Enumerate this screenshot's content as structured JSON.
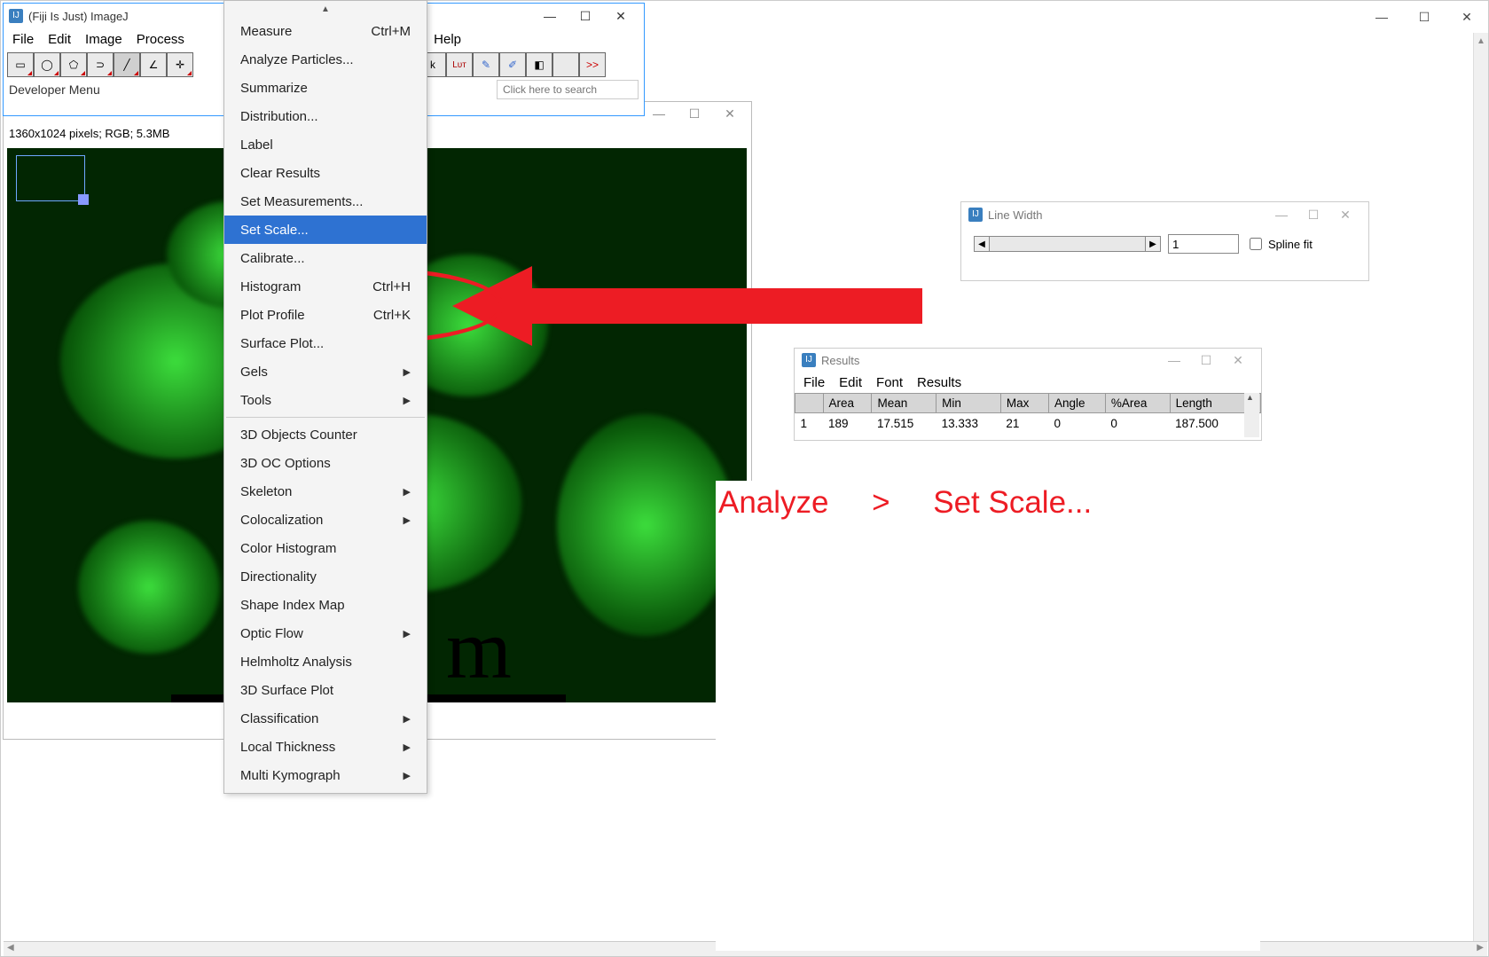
{
  "outer": {
    "minimize": "—",
    "maximize": "☐",
    "close": "✕"
  },
  "ij": {
    "icon_text": "IJ",
    "title": "(Fiji Is Just) ImageJ",
    "minimize": "—",
    "maximize": "☐",
    "close": "✕",
    "menus": {
      "file": "File",
      "edit": "Edit",
      "image": "Image",
      "process": "Process",
      "help": "Help"
    },
    "tools": {
      "rect": "▭",
      "oval": "◯",
      "poly": "⬠",
      "free": "⊃",
      "line": "╱",
      "angle": "∠",
      "point": "✛",
      "wand": "k",
      "lut": "Lᴜᴛ",
      "pencil": "✎",
      "brush": "✐",
      "eraser": "◧",
      "blank": " ",
      "more": ">>"
    },
    "status": "Developer Menu",
    "search_placeholder": "Click here to search"
  },
  "image": {
    "min": "—",
    "max": "☐",
    "close": "✕",
    "info": "1360x1024 pixels; RGB; 5.3MB",
    "scale_glyph": "m"
  },
  "analyze_menu": {
    "items": [
      {
        "label": "Measure",
        "shortcut": "Ctrl+M"
      },
      {
        "label": "Analyze Particles..."
      },
      {
        "label": "Summarize"
      },
      {
        "label": "Distribution..."
      },
      {
        "label": "Label"
      },
      {
        "label": "Clear Results"
      },
      {
        "label": "Set Measurements..."
      },
      {
        "label": "Set Scale...",
        "selected": true
      },
      {
        "label": "Calibrate..."
      },
      {
        "label": "Histogram",
        "shortcut": "Ctrl+H"
      },
      {
        "label": "Plot Profile",
        "shortcut": "Ctrl+K"
      },
      {
        "label": "Surface Plot..."
      },
      {
        "label": "Gels",
        "submenu": true
      },
      {
        "label": "Tools",
        "submenu": true
      },
      {
        "sep": true
      },
      {
        "label": "3D Objects Counter"
      },
      {
        "label": "3D OC Options"
      },
      {
        "label": "Skeleton",
        "submenu": true
      },
      {
        "label": "Colocalization",
        "submenu": true
      },
      {
        "label": "Color Histogram"
      },
      {
        "label": "Directionality"
      },
      {
        "label": "Shape Index Map"
      },
      {
        "label": "Optic Flow",
        "submenu": true
      },
      {
        "label": "Helmholtz Analysis"
      },
      {
        "label": "3D Surface Plot"
      },
      {
        "label": "Classification",
        "submenu": true
      },
      {
        "label": "Local Thickness",
        "submenu": true
      },
      {
        "label": "Multi Kymograph",
        "submenu": true
      }
    ]
  },
  "linewidth": {
    "title": "Line Width",
    "value": "1",
    "checkbox_label": "Spline fit",
    "min": "—",
    "max": "☐",
    "close": "✕"
  },
  "results": {
    "title": "Results",
    "menus": {
      "file": "File",
      "edit": "Edit",
      "font": "Font",
      "results": "Results"
    },
    "headers": [
      "",
      "Area",
      "Mean",
      "Min",
      "Max",
      "Angle",
      "%Area",
      "Length"
    ],
    "rows": [
      [
        "1",
        "189",
        "17.515",
        "13.333",
        "21",
        "0",
        "0",
        "187.500"
      ]
    ],
    "min": "—",
    "max": "☐",
    "close": "✕"
  },
  "annotation": {
    "breadcrumb_analyze": "Analyze",
    "breadcrumb_sep": ">",
    "breadcrumb_target": "Set Scale..."
  }
}
